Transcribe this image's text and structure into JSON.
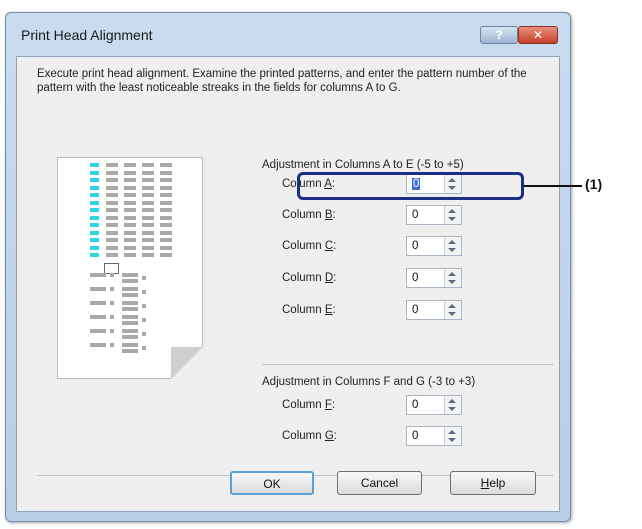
{
  "window": {
    "title": "Print Head Alignment",
    "help_glyph": "?",
    "close_glyph": "✕"
  },
  "description": "Execute print head alignment. Examine the printed patterns, and enter the pattern number of the pattern with the least noticeable streaks in the fields for columns A to G.",
  "group1": {
    "label": "Adjustment in Columns A to E (-5 to +5)",
    "fields": [
      {
        "label_prefix": "Column ",
        "mnemonic": "A",
        "label_suffix": ":",
        "value": "0"
      },
      {
        "label_prefix": "Column ",
        "mnemonic": "B",
        "label_suffix": ":",
        "value": "0"
      },
      {
        "label_prefix": "Column ",
        "mnemonic": "C",
        "label_suffix": ":",
        "value": "0"
      },
      {
        "label_prefix": "Column ",
        "mnemonic": "D",
        "label_suffix": ":",
        "value": "0"
      },
      {
        "label_prefix": "Column ",
        "mnemonic": "E",
        "label_suffix": ":",
        "value": "0"
      }
    ]
  },
  "group2": {
    "label": "Adjustment in Columns F and G (-3 to +3)",
    "fields": [
      {
        "label_prefix": "Column ",
        "mnemonic": "F",
        "label_suffix": ":",
        "value": "0"
      },
      {
        "label_prefix": "Column ",
        "mnemonic": "G",
        "label_suffix": ":",
        "value": "0"
      }
    ]
  },
  "callout": "(1)",
  "buttons": {
    "ok": "OK",
    "cancel": "Cancel",
    "help_mnemonic": "H",
    "help_rest": "elp"
  },
  "icons": {
    "help": "help-icon",
    "close": "close-icon",
    "spin": "spin-arrows-icon"
  },
  "colors": {
    "pattern_cyan": "#2fd6e6",
    "callout_border": "#1b2f86",
    "close_red": "#c4402a"
  }
}
